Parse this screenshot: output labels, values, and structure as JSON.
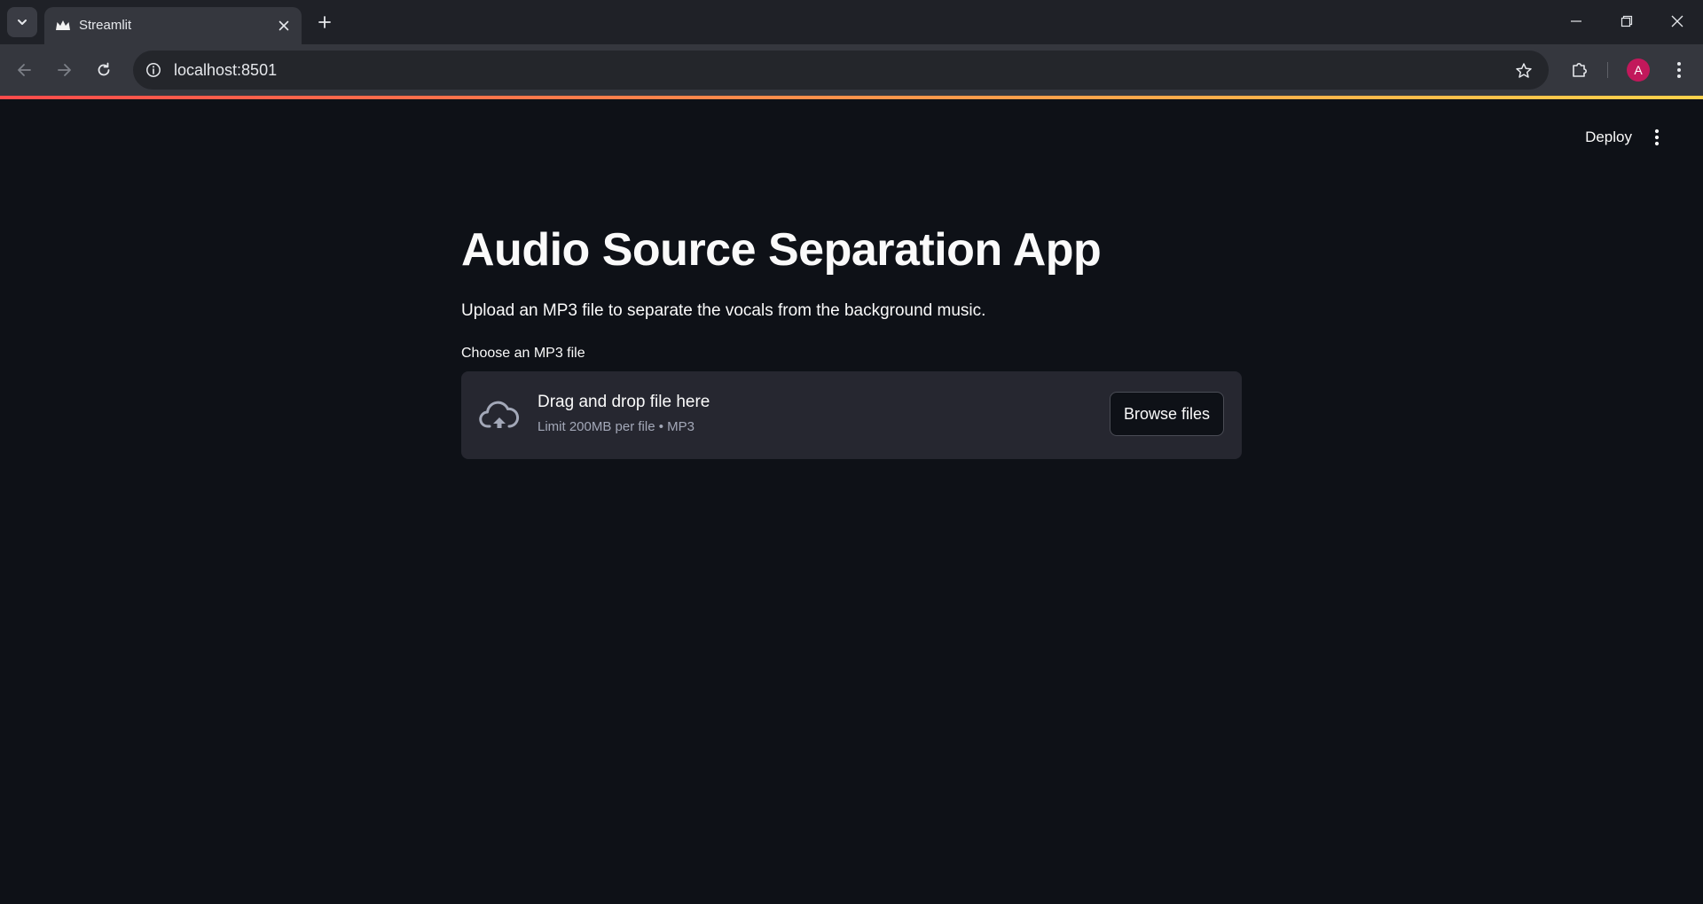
{
  "browser": {
    "tab_title": "Streamlit",
    "url": "localhost:8501",
    "profile_initial": "A",
    "icons": {
      "tab_search": "chevron-down-icon",
      "favicon": "streamlit-crown-icon",
      "tab_close": "close-icon",
      "new_tab": "plus-icon",
      "back": "arrow-left-icon",
      "forward": "arrow-right-icon",
      "reload": "reload-icon",
      "site_info": "info-icon",
      "bookmark": "star-icon",
      "extensions": "puzzle-icon",
      "menu": "kebab-menu-icon",
      "minimize": "minimize-icon",
      "restore": "restore-icon",
      "close_window": "close-icon"
    }
  },
  "header": {
    "deploy_label": "Deploy",
    "menu_icon": "kebab-menu-icon",
    "accent_gradient": [
      "#ff4b4b",
      "#ff8c4b",
      "#ffd24b"
    ]
  },
  "main": {
    "title": "Audio Source Separation App",
    "description": "Upload an MP3 file to separate the vocals from the background music.",
    "uploader": {
      "label": "Choose an MP3 file",
      "dropzone_title": "Drag and drop file here",
      "limit_text": "Limit 200MB per file • MP3",
      "button_label": "Browse files",
      "icon": "cloud-upload-icon"
    }
  },
  "colors": {
    "app_background": "#0e1117",
    "dropzone_background": "#262730",
    "text": "#fafafa",
    "muted_text": "#a3a8b8",
    "avatar": "#c2185b"
  }
}
